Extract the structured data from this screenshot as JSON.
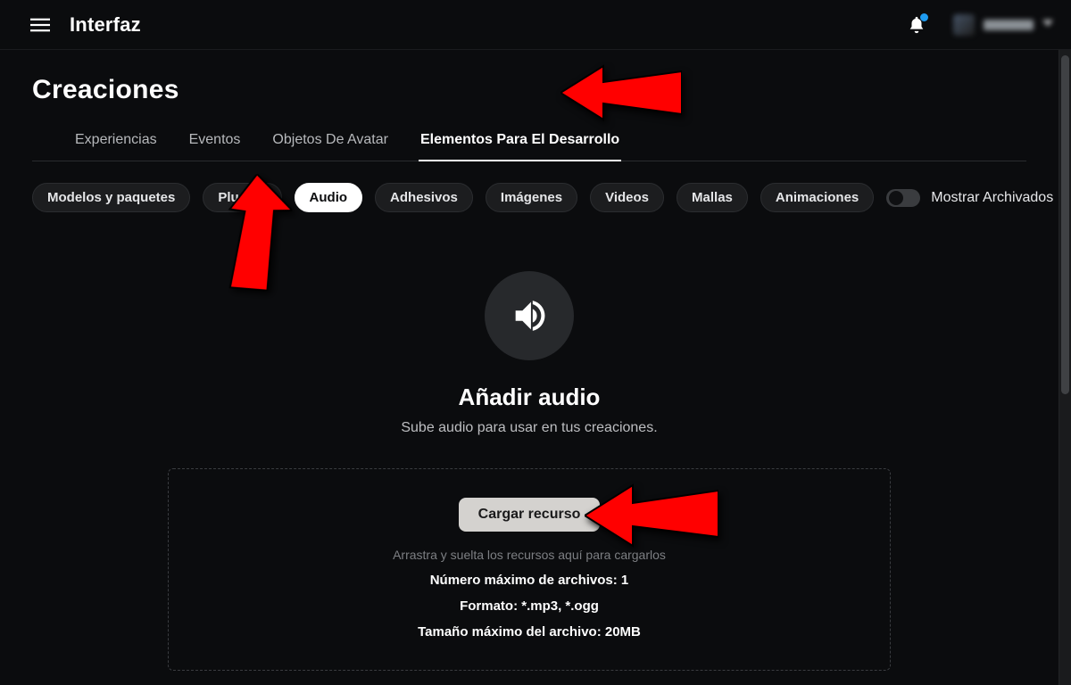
{
  "app": {
    "title": "Interfaz",
    "username": "user"
  },
  "page": {
    "title": "Creaciones"
  },
  "tabs": {
    "items": [
      {
        "label": "Experiencias"
      },
      {
        "label": "Eventos"
      },
      {
        "label": "Objetos De Avatar"
      },
      {
        "label": "Elementos Para El Desarrollo"
      }
    ],
    "active_index": 3
  },
  "filters": {
    "items": [
      {
        "label": "Modelos y paquetes"
      },
      {
        "label": "Plugins"
      },
      {
        "label": "Audio"
      },
      {
        "label": "Adhesivos"
      },
      {
        "label": "Imágenes"
      },
      {
        "label": "Videos"
      },
      {
        "label": "Mallas"
      },
      {
        "label": "Animaciones"
      }
    ],
    "active_index": 2,
    "archived_label": "Mostrar Archivados"
  },
  "empty": {
    "title": "Añadir audio",
    "subtitle": "Sube audio para usar en tus creaciones."
  },
  "drop": {
    "button": "Cargar recurso",
    "hint": "Arrastra y suelta los recursos aquí para cargarlos",
    "line1": "Número máximo de archivos: 1",
    "line2": "Formato: *.mp3, *.ogg",
    "line3": "Tamaño máximo del archivo: 20MB"
  },
  "annotations": {
    "arrow_tab": "red-arrow",
    "arrow_chip": "red-arrow",
    "arrow_button": "red-arrow"
  }
}
